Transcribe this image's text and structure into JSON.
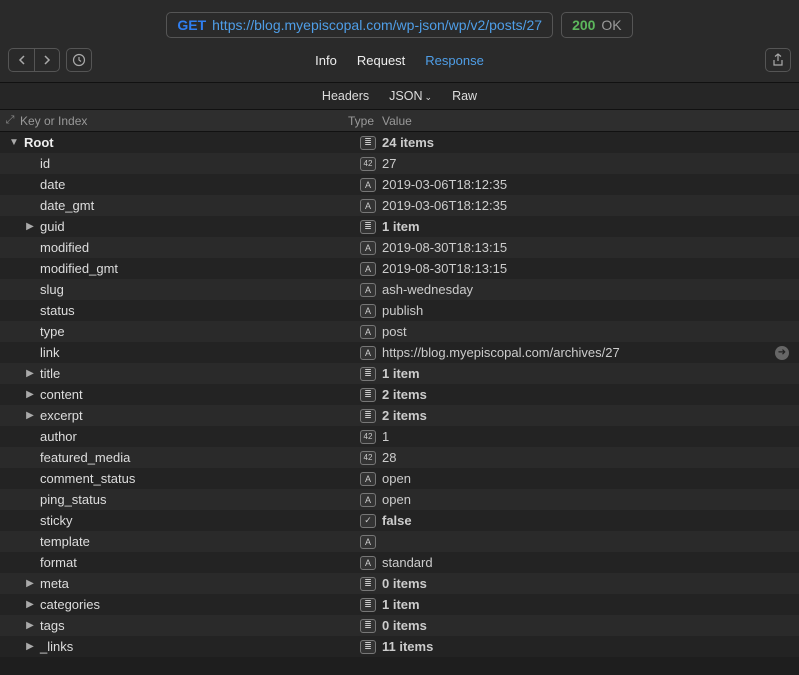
{
  "request": {
    "method": "GET",
    "url": "https://blog.myepiscopal.com/wp-json/wp/v2/posts/27",
    "status_code": "200",
    "status_text": "OK"
  },
  "nav": {
    "info": "Info",
    "request": "Request",
    "response": "Response"
  },
  "subtabs": {
    "headers": "Headers",
    "json": "JSON",
    "raw": "Raw"
  },
  "columns": {
    "key": "Key or Index",
    "type": "Type",
    "value": "Value"
  },
  "types": {
    "object": "≣",
    "string": "A",
    "number": "42",
    "bool": "✓"
  },
  "tree": [
    {
      "indent": 0,
      "disclosure": "down",
      "key": "Root",
      "root": true,
      "type": "object",
      "value": "24 items",
      "bold": true
    },
    {
      "indent": 1,
      "key": "id",
      "type": "number",
      "value": "27"
    },
    {
      "indent": 1,
      "key": "date",
      "type": "string",
      "value": "2019-03-06T18:12:35"
    },
    {
      "indent": 1,
      "key": "date_gmt",
      "type": "string",
      "value": "2019-03-06T18:12:35"
    },
    {
      "indent": 1,
      "disclosure": "right",
      "key": "guid",
      "type": "object",
      "value": "1 item",
      "bold": true
    },
    {
      "indent": 1,
      "key": "modified",
      "type": "string",
      "value": "2019-08-30T18:13:15"
    },
    {
      "indent": 1,
      "key": "modified_gmt",
      "type": "string",
      "value": "2019-08-30T18:13:15"
    },
    {
      "indent": 1,
      "key": "slug",
      "type": "string",
      "value": "ash-wednesday"
    },
    {
      "indent": 1,
      "key": "status",
      "type": "string",
      "value": "publish"
    },
    {
      "indent": 1,
      "key": "type",
      "type": "string",
      "value": "post"
    },
    {
      "indent": 1,
      "key": "link",
      "type": "string",
      "value": "https://blog.myepiscopal.com/archives/27",
      "link": true
    },
    {
      "indent": 1,
      "disclosure": "right",
      "key": "title",
      "type": "object",
      "value": "1 item",
      "bold": true
    },
    {
      "indent": 1,
      "disclosure": "right",
      "key": "content",
      "type": "object",
      "value": "2 items",
      "bold": true
    },
    {
      "indent": 1,
      "disclosure": "right",
      "key": "excerpt",
      "type": "object",
      "value": "2 items",
      "bold": true
    },
    {
      "indent": 1,
      "key": "author",
      "type": "number",
      "value": "1"
    },
    {
      "indent": 1,
      "key": "featured_media",
      "type": "number",
      "value": "28"
    },
    {
      "indent": 1,
      "key": "comment_status",
      "type": "string",
      "value": "open"
    },
    {
      "indent": 1,
      "key": "ping_status",
      "type": "string",
      "value": "open"
    },
    {
      "indent": 1,
      "key": "sticky",
      "type": "bool",
      "value": "false",
      "bold": true
    },
    {
      "indent": 1,
      "key": "template",
      "type": "string",
      "value": ""
    },
    {
      "indent": 1,
      "key": "format",
      "type": "string",
      "value": "standard"
    },
    {
      "indent": 1,
      "disclosure": "right",
      "key": "meta",
      "type": "object",
      "value": "0 items",
      "bold": true
    },
    {
      "indent": 1,
      "disclosure": "right",
      "key": "categories",
      "type": "object",
      "value": "1 item",
      "bold": true
    },
    {
      "indent": 1,
      "disclosure": "right",
      "key": "tags",
      "type": "object",
      "value": "0 items",
      "bold": true
    },
    {
      "indent": 1,
      "disclosure": "right",
      "key": "_links",
      "type": "object",
      "value": "11 items",
      "bold": true
    }
  ]
}
